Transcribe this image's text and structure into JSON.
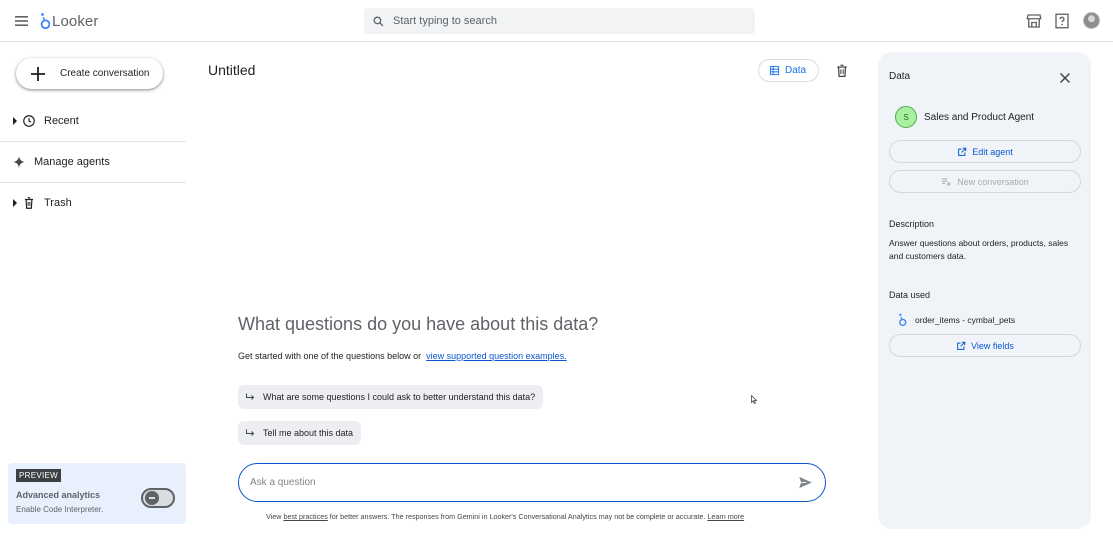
{
  "app": {
    "name": "Looker"
  },
  "search": {
    "placeholder": "Start typing to search"
  },
  "sidebar": {
    "create_label": "Create conversation",
    "items": [
      {
        "label": "Recent",
        "icon": "clock-icon"
      },
      {
        "label": "Manage agents",
        "icon": "sparkle-icon"
      },
      {
        "label": "Trash",
        "icon": "trash-icon"
      }
    ],
    "preview": {
      "badge": "PREVIEW",
      "title": "Advanced analytics",
      "subtitle": "Enable Code Interpreter.",
      "enabled": false
    }
  },
  "main": {
    "title": "Untitled",
    "data_button": "Data",
    "headline": "What questions do you have about this data?",
    "intro_text": "Get started with one of the questions below or",
    "intro_link": "view supported question examples.",
    "suggestions": [
      "What are some questions I could ask to better understand this data?",
      "Tell me about this data"
    ],
    "ask_placeholder": "Ask a question",
    "disclaimer": {
      "prefix": "View",
      "link1": "best practices",
      "middle": "for better answers. The responses from Gemini in Looker's Conversational Analytics may not be complete or accurate.",
      "link2": "Learn more"
    }
  },
  "panel": {
    "title": "Data",
    "agent": {
      "initial": "S",
      "name": "Sales and Product Agent"
    },
    "edit_label": "Edit agent",
    "new_conversation_label": "New conversation",
    "description_label": "Description",
    "description": "Answer questions about orders, products, sales and customers data.",
    "data_used_label": "Data used",
    "dataset": "order_items - cymbal_pets",
    "view_fields_label": "View fields"
  },
  "colors": {
    "accent": "#0b57d0",
    "panel_bg": "#f0f4f9",
    "agent_avatar": "#a8f0a0"
  }
}
